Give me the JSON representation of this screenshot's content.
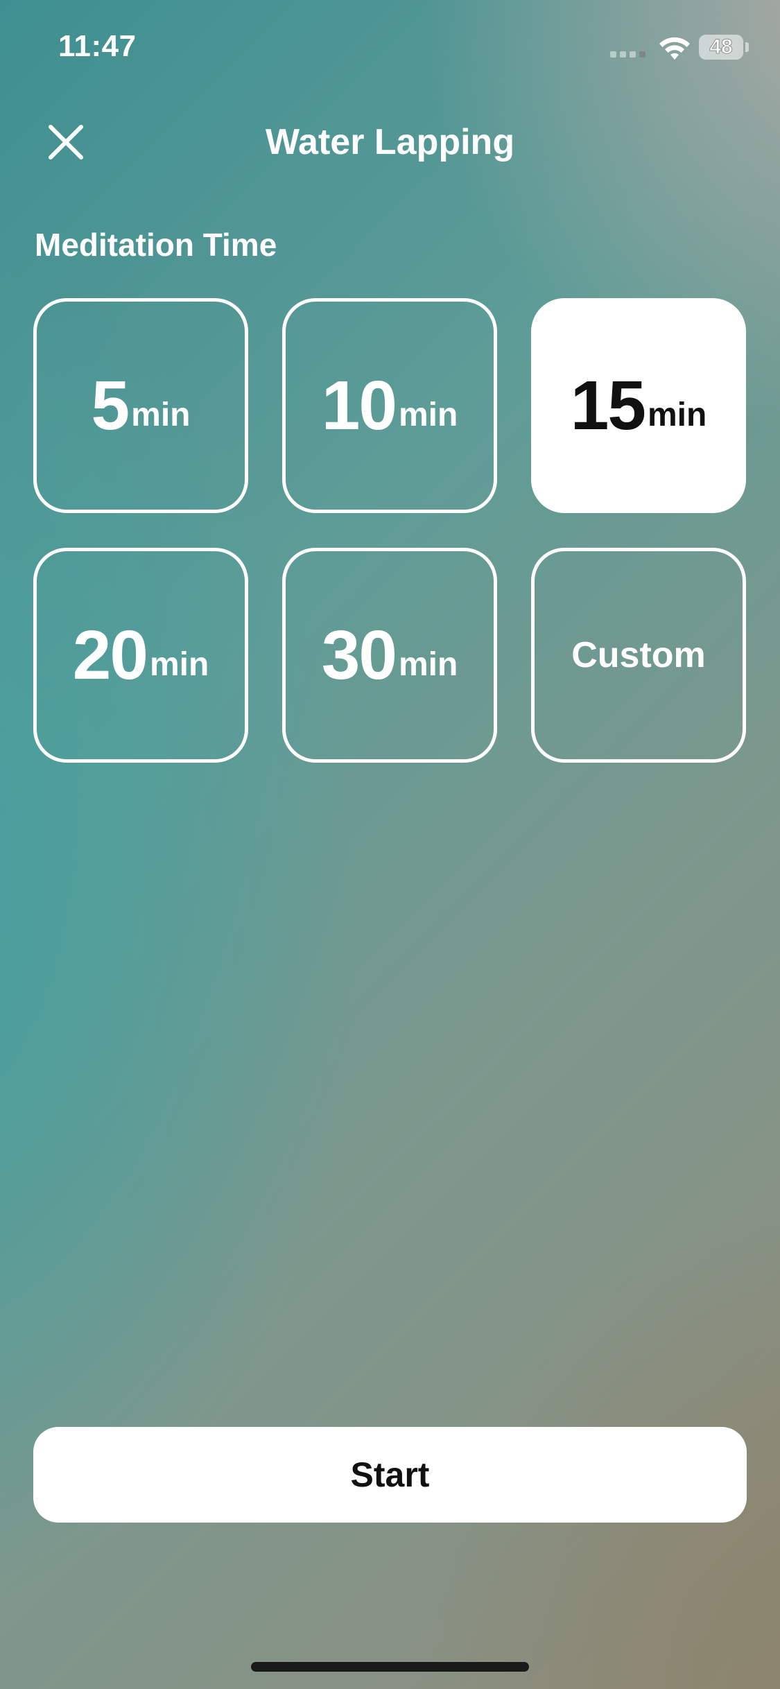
{
  "status_bar": {
    "time": "11:47",
    "battery": "48",
    "icons": [
      "signal-icon",
      "wifi-icon",
      "battery-icon"
    ]
  },
  "header": {
    "title": "Water Lapping",
    "close_icon": "close-icon"
  },
  "section": {
    "label": "Meditation Time"
  },
  "durations": [
    {
      "value": "5",
      "unit": "min",
      "selected": false
    },
    {
      "value": "10",
      "unit": "min",
      "selected": false
    },
    {
      "value": "15",
      "unit": "min",
      "selected": true
    },
    {
      "value": "20",
      "unit": "min",
      "selected": false
    },
    {
      "value": "30",
      "unit": "min",
      "selected": false
    }
  ],
  "custom_label": "Custom",
  "start_label": "Start",
  "colors": {
    "accent": "#ffffff",
    "selected_text": "#111111",
    "background_teal": "#4a9a98",
    "background_warm": "#8f8c7c"
  }
}
